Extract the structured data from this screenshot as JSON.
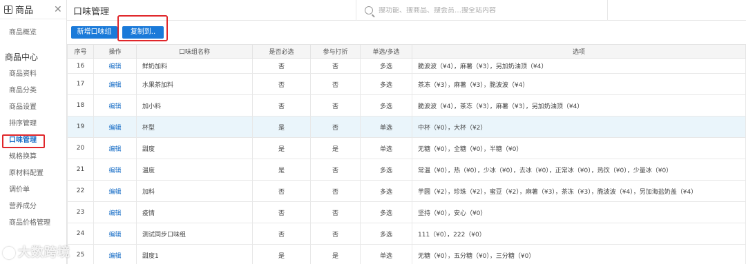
{
  "sidebar": {
    "title": "商品",
    "close": "✕",
    "overview": "商品概览",
    "group": "商品中心",
    "items": [
      "商品资料",
      "商品分类",
      "商品设置",
      "排序管理",
      "口味管理",
      "规格换算",
      "原材料配置",
      "调价单",
      "营养成分",
      "商品价格管理"
    ]
  },
  "header": {
    "title": "口味管理",
    "search_placeholder": "搜功能、搜商品、搜会员…搜全站内容"
  },
  "toolbar": {
    "new_label": "新增口味组",
    "copy_label": "复制到.."
  },
  "table": {
    "columns": [
      "序号",
      "操作",
      "口味组名称",
      "是否必选",
      "参与打折",
      "单选/多选",
      "选项"
    ],
    "rows": [
      {
        "no": "16",
        "op": "编辑",
        "name": "鲜奶加料",
        "required": "否",
        "discount": "否",
        "mode": "多选",
        "options": "脆波波（¥4），麻薯（¥3），另加奶油顶（¥4）"
      },
      {
        "no": "17",
        "op": "编辑",
        "name": "水果茶加料",
        "required": "否",
        "discount": "否",
        "mode": "多选",
        "options": "茶冻（¥3），麻薯（¥3），脆波波（¥4）"
      },
      {
        "no": "18",
        "op": "编辑",
        "name": "加小料",
        "required": "否",
        "discount": "否",
        "mode": "多选",
        "options": "脆波波（¥4），茶冻（¥3），麻薯（¥3），另加奶油顶（¥4）"
      },
      {
        "no": "19",
        "op": "编辑",
        "name": "杯型",
        "required": "是",
        "discount": "否",
        "mode": "单选",
        "options": "中杯（¥0），大杯（¥2）"
      },
      {
        "no": "20",
        "op": "编辑",
        "name": "甜度",
        "required": "是",
        "discount": "是",
        "mode": "单选",
        "options": "无糖（¥0），全糖（¥0），半糖（¥0）"
      },
      {
        "no": "21",
        "op": "编辑",
        "name": "温度",
        "required": "是",
        "discount": "否",
        "mode": "多选",
        "options": "常温（¥0），热（¥0），少冰（¥0），去冰（¥0），正常冰（¥0），热饮（¥0），少量冰（¥0）"
      },
      {
        "no": "22",
        "op": "编辑",
        "name": "加料",
        "required": "否",
        "discount": "否",
        "mode": "多选",
        "options": "芋圆（¥2），珍珠（¥2），蜜豆（¥2），麻薯（¥3），茶冻（¥3），脆波波（¥4），另加海盐奶盖（¥4）"
      },
      {
        "no": "23",
        "op": "编辑",
        "name": "疫情",
        "required": "否",
        "discount": "否",
        "mode": "多选",
        "options": "坚持（¥0），安心（¥0）"
      },
      {
        "no": "24",
        "op": "编辑",
        "name": "测试同步口味组",
        "required": "否",
        "discount": "否",
        "mode": "多选",
        "options": "111（¥0），222（¥0）"
      },
      {
        "no": "25",
        "op": "编辑",
        "name": "甜度1",
        "required": "是",
        "discount": "是",
        "mode": "单选",
        "options": "无糖（¥0），五分糖（¥0），三分糖（¥0）"
      }
    ]
  },
  "watermark": "大数跨境"
}
